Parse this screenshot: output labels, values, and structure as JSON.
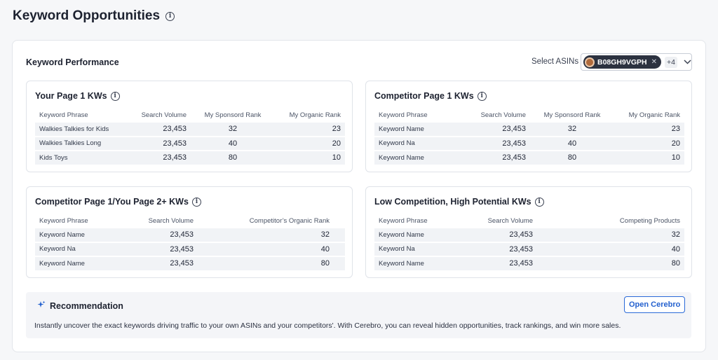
{
  "page": {
    "title": "Keyword Opportunities"
  },
  "performance": {
    "title": "Keyword Performance",
    "select_label": "Select ASINs",
    "asin_chip": "B08GH9VGPH",
    "asin_more": "+4"
  },
  "cards": {
    "your_page1": {
      "title": "Your Page 1 KWs",
      "headers": [
        "Keyword Phrase",
        "Search Volume",
        "My Sponsord Rank",
        "My Organic Rank"
      ],
      "rows": [
        [
          "Walkies Talkies for Kids",
          "23,453",
          "32",
          "23"
        ],
        [
          "Walkies Talkies Long",
          "23,453",
          "40",
          "20"
        ],
        [
          "Kids Toys",
          "23,453",
          "80",
          "10"
        ]
      ]
    },
    "competitor_page1": {
      "title": "Competitor Page 1 KWs",
      "headers": [
        "Keyword Phrase",
        "Search Volume",
        "My Sponsord Rank",
        "My Organic Rank"
      ],
      "rows": [
        [
          "Keyword Name",
          "23,453",
          "32",
          "23"
        ],
        [
          "Keyword Na",
          "23,453",
          "40",
          "20"
        ],
        [
          "Keyword Name",
          "23,453",
          "80",
          "10"
        ]
      ]
    },
    "competitor_you2": {
      "title": "Competitor Page 1/You Page 2+ KWs",
      "headers": [
        "Keyword Phrase",
        "Search Volume",
        "Competitor’s Organic Rank"
      ],
      "rows": [
        [
          "Keyword Name",
          "23,453",
          "32"
        ],
        [
          "Keyword Na",
          "23,453",
          "40"
        ],
        [
          "Keyword Name",
          "23,453",
          "80"
        ]
      ]
    },
    "low_competition": {
      "title": "Low Competition, High Potential KWs",
      "headers": [
        "Keyword Phrase",
        "Search Volume",
        "Competing Products"
      ],
      "rows": [
        [
          "Keyword Name",
          "23,453",
          "32"
        ],
        [
          "Keyword Na",
          "23,453",
          "40"
        ],
        [
          "Keyword Name",
          "23,453",
          "80"
        ]
      ]
    }
  },
  "recommendation": {
    "title": "Recommendation",
    "text": "Instantly uncover the exact keywords driving traffic to your own ASINs and your competitors'. With Cerebro, you can reveal hidden opportunities, track rankings, and win more sales.",
    "button": "Open Cerebro"
  },
  "colors": {
    "accent": "#2461cf",
    "chip_bg": "#2c3240",
    "row_bg": "#f1f3f6"
  }
}
